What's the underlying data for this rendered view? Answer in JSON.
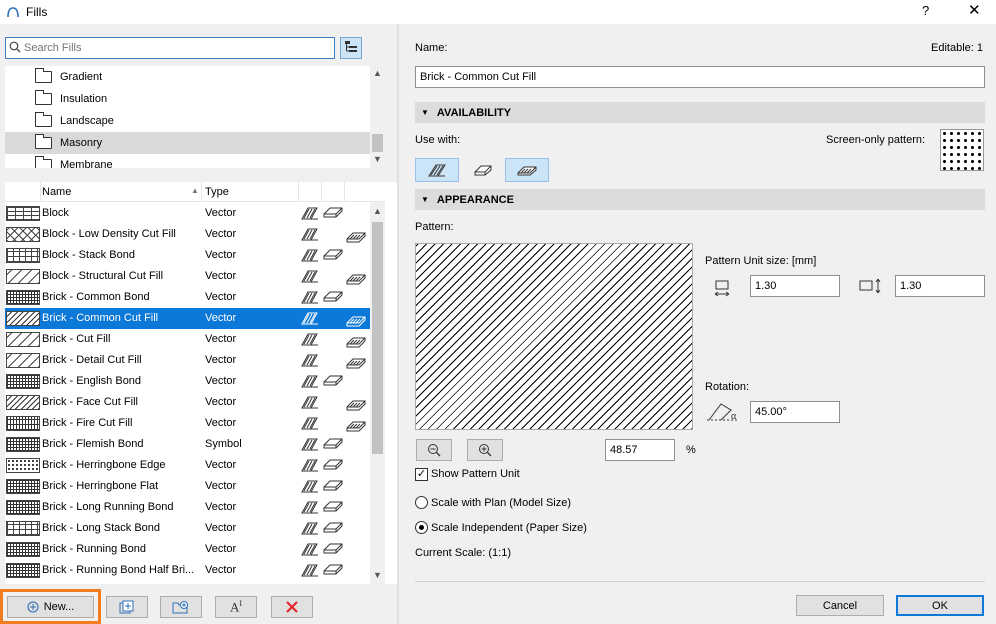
{
  "window": {
    "title": "Fills",
    "help": "?",
    "close": "✕"
  },
  "search": {
    "placeholder": "Search Fills"
  },
  "folders": [
    {
      "label": "Gradient",
      "selected": false
    },
    {
      "label": "Insulation",
      "selected": false
    },
    {
      "label": "Landscape",
      "selected": false
    },
    {
      "label": "Masonry",
      "selected": true
    },
    {
      "label": "Membrane",
      "selected": false
    }
  ],
  "list": {
    "columns": {
      "name": "Name",
      "type": "Type"
    },
    "rows": [
      {
        "name": "Block",
        "type": "Vector",
        "pattern": "brick",
        "uses": [
          true,
          true,
          false
        ]
      },
      {
        "name": "Block - Low Density Cut Fill",
        "type": "Vector",
        "pattern": "cross",
        "uses": [
          true,
          false,
          true
        ]
      },
      {
        "name": "Block - Stack Bond",
        "type": "Vector",
        "pattern": "grid",
        "uses": [
          true,
          true,
          false
        ]
      },
      {
        "name": "Block - Structural Cut Fill",
        "type": "Vector",
        "pattern": "diag",
        "uses": [
          true,
          false,
          true
        ]
      },
      {
        "name": "Brick - Common Bond",
        "type": "Vector",
        "pattern": "dense",
        "uses": [
          true,
          true,
          false
        ]
      },
      {
        "name": "Brick - Common Cut Fill",
        "type": "Vector",
        "pattern": "diag2",
        "uses": [
          true,
          false,
          true
        ],
        "selected": true
      },
      {
        "name": "Brick - Cut Fill",
        "type": "Vector",
        "pattern": "diag",
        "uses": [
          true,
          false,
          true
        ]
      },
      {
        "name": "Brick - Detail Cut Fill",
        "type": "Vector",
        "pattern": "diag",
        "uses": [
          true,
          false,
          true
        ]
      },
      {
        "name": "Brick - English Bond",
        "type": "Vector",
        "pattern": "dense",
        "uses": [
          true,
          true,
          false
        ]
      },
      {
        "name": "Brick - Face Cut Fill",
        "type": "Vector",
        "pattern": "diag2",
        "uses": [
          true,
          false,
          true
        ]
      },
      {
        "name": "Brick - Fire Cut Fill",
        "type": "Vector",
        "pattern": "vert",
        "uses": [
          true,
          false,
          true
        ]
      },
      {
        "name": "Brick - Flemish Bond",
        "type": "Symbol",
        "pattern": "dense",
        "uses": [
          true,
          true,
          false
        ]
      },
      {
        "name": "Brick - Herringbone Edge",
        "type": "Vector",
        "pattern": "dots",
        "uses": [
          true,
          true,
          false
        ]
      },
      {
        "name": "Brick - Herringbone Flat",
        "type": "Vector",
        "pattern": "dense",
        "uses": [
          true,
          true,
          false
        ]
      },
      {
        "name": "Brick - Long Running Bond",
        "type": "Vector",
        "pattern": "dense",
        "uses": [
          true,
          true,
          false
        ]
      },
      {
        "name": "Brick - Long Stack Bond",
        "type": "Vector",
        "pattern": "grid",
        "uses": [
          true,
          true,
          false
        ]
      },
      {
        "name": "Brick - Running Bond",
        "type": "Vector",
        "pattern": "dense",
        "uses": [
          true,
          true,
          false
        ]
      },
      {
        "name": "Brick - Running Bond Half Bri...",
        "type": "Vector",
        "pattern": "dense",
        "uses": [
          true,
          true,
          false
        ]
      }
    ]
  },
  "bottom": {
    "new_label": "New..."
  },
  "detail": {
    "name_label": "Name:",
    "editable": "Editable: 1",
    "name_value": "Brick - Common Cut Fill",
    "availability": "AVAILABILITY",
    "use_with": "Use with:",
    "screen_only": "Screen-only pattern:",
    "appearance": "APPEARANCE",
    "pattern_label": "Pattern:",
    "unit_size_label": "Pattern Unit size: [mm]",
    "unit_x": "1.30",
    "unit_y": "1.30",
    "rotation_label": "Rotation:",
    "rotation_value": "45.00°",
    "zoom_value": "48.57",
    "zoom_unit": "%",
    "show_unit": "Show Pattern Unit",
    "scale_plan": "Scale with Plan (Model Size)",
    "scale_indep": "Scale Independent (Paper Size)",
    "current_scale": "Current Scale: (1:1)",
    "cancel": "Cancel",
    "ok": "OK"
  }
}
